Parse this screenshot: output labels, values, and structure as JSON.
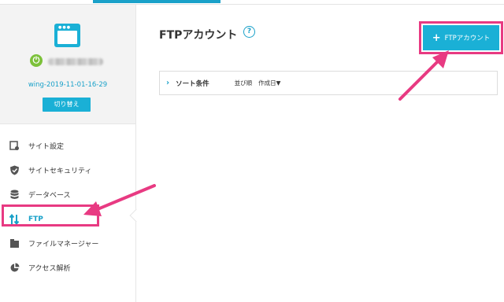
{
  "colors": {
    "accent": "#1aa1c9",
    "button": "#1ab0d6",
    "highlight": "#e83a82",
    "status_green": "#7cc13a"
  },
  "sidebar": {
    "site_id": "wing-2019-11-01-16-29",
    "switch_label": "切り替え",
    "items": [
      {
        "label": "サイト設定",
        "icon": "site-settings-icon"
      },
      {
        "label": "サイトセキュリティ",
        "icon": "shield-icon"
      },
      {
        "label": "データベース",
        "icon": "database-icon"
      },
      {
        "label": "FTP",
        "icon": "transfer-arrows-icon",
        "active": true
      },
      {
        "label": "ファイルマネージャー",
        "icon": "folder-icon"
      },
      {
        "label": "アクセス解析",
        "icon": "pie-chart-icon"
      }
    ]
  },
  "main": {
    "title": "FTPアカウント",
    "add_button_label": "FTPアカウント",
    "sort": {
      "title": "ソート条件",
      "order_label": "並び順",
      "order_value": "作成日▼"
    }
  }
}
